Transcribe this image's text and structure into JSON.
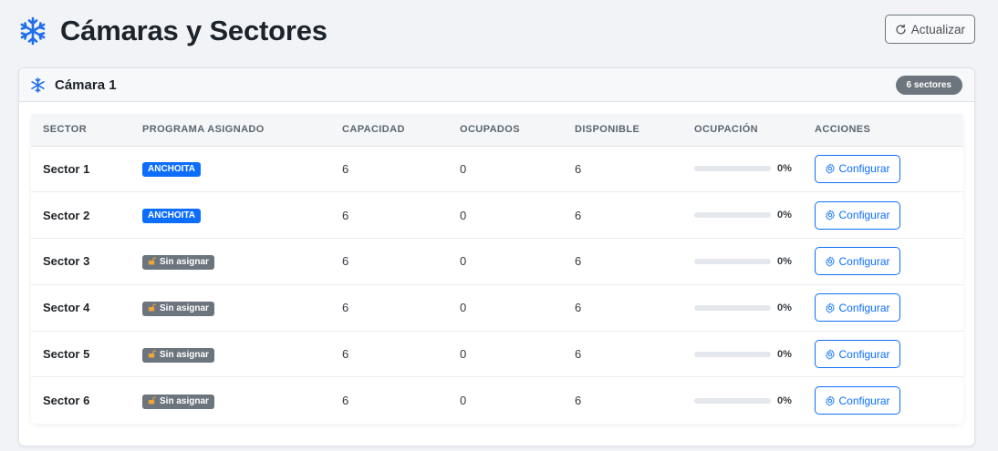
{
  "header": {
    "title": "Cámaras y Sectores",
    "icon": "snowflake-icon",
    "refresh_label": "Actualizar",
    "accent": "#1f6feb"
  },
  "camera": {
    "title": "Cámara 1",
    "sector_count_label": "6 sectores"
  },
  "table": {
    "columns": [
      "SECTOR",
      "PROGRAMA ASIGNADO",
      "CAPACIDAD",
      "OCUPADOS",
      "DISPONIBLE",
      "OCUPACIÓN",
      "ACCIONES"
    ],
    "rows": [
      {
        "sector": "Sector 1",
        "program": "ANCHOITA",
        "assigned": true,
        "capacity": "6",
        "occupied": "0",
        "available": "6",
        "occupancy_pct": "0%",
        "occupancy_fraction": 0,
        "action": "Configurar"
      },
      {
        "sector": "Sector 2",
        "program": "ANCHOITA",
        "assigned": true,
        "capacity": "6",
        "occupied": "0",
        "available": "6",
        "occupancy_pct": "0%",
        "occupancy_fraction": 0,
        "action": "Configurar"
      },
      {
        "sector": "Sector 3",
        "program": "Sin asignar",
        "assigned": false,
        "capacity": "6",
        "occupied": "0",
        "available": "6",
        "occupancy_pct": "0%",
        "occupancy_fraction": 0,
        "action": "Configurar"
      },
      {
        "sector": "Sector 4",
        "program": "Sin asignar",
        "assigned": false,
        "capacity": "6",
        "occupied": "0",
        "available": "6",
        "occupancy_pct": "0%",
        "occupancy_fraction": 0,
        "action": "Configurar"
      },
      {
        "sector": "Sector 5",
        "program": "Sin asignar",
        "assigned": false,
        "capacity": "6",
        "occupied": "0",
        "available": "6",
        "occupancy_pct": "0%",
        "occupancy_fraction": 0,
        "action": "Configurar"
      },
      {
        "sector": "Sector 6",
        "program": "Sin asignar",
        "assigned": false,
        "capacity": "6",
        "occupied": "0",
        "available": "6",
        "occupancy_pct": "0%",
        "occupancy_fraction": 0,
        "action": "Configurar"
      }
    ]
  },
  "colors": {
    "assigned_badge": "#0d6efd",
    "unassigned_badge": "#6c757d",
    "button": "#0d6efd"
  }
}
